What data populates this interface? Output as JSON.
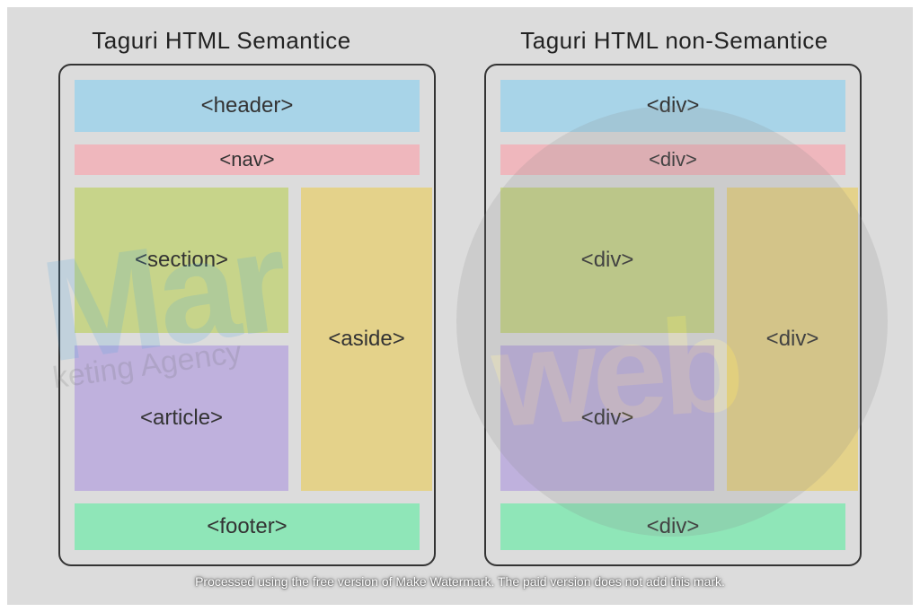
{
  "titles": {
    "semantic": "Taguri HTML Semantice",
    "nonsemantic": "Taguri HTML non-Semantice"
  },
  "semantic": {
    "header": "<header>",
    "nav": "<nav>",
    "section": "<section>",
    "article": "<article>",
    "aside": "<aside>",
    "footer": "<footer>"
  },
  "nonsemantic": {
    "header": "<div>",
    "nav": "<div>",
    "section": "<div>",
    "article": "<div>",
    "aside": "<div>",
    "footer": "<div>"
  },
  "watermark": {
    "note": "Processed using the free version of Make Watermark. The paid version does not add this mark.",
    "brand1": "Mar",
    "brand2": "web",
    "sub": "keting Agency"
  }
}
